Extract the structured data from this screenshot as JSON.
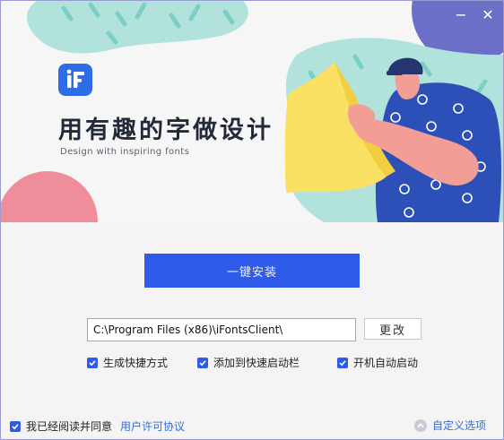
{
  "window": {
    "minimize_glyph": "−",
    "close_glyph": "✕"
  },
  "banner": {
    "logo_icon": "ifonts-logo-icon",
    "title": "用有趣的字做设计",
    "subtitle": "Design with inspiring fonts"
  },
  "install": {
    "button_label": "一键安装",
    "path_value": "C:\\Program Files (x86)\\iFontsClient\\",
    "change_label": "更改"
  },
  "options": [
    {
      "label": "生成快捷方式",
      "checked": true
    },
    {
      "label": "添加到快速启动栏",
      "checked": true
    },
    {
      "label": "开机自动启动",
      "checked": true
    }
  ],
  "footer": {
    "agree_text": "我已经阅读并同意",
    "agree_checked": true,
    "license_link": "用户许可协议",
    "custom_label": "自定义选项"
  },
  "colors": {
    "accent": "#2e5bea",
    "link": "#2e70d8",
    "purple_blob": "#6b6fc8",
    "teal_blob": "#b2e2dc",
    "pink_blob": "#ef8d9a",
    "yellow_paper": "#fbe163"
  }
}
